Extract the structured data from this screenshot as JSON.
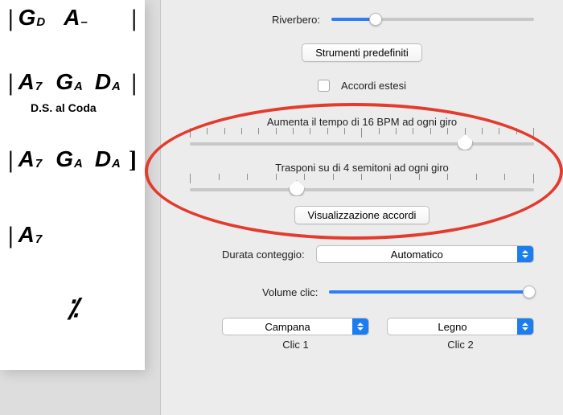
{
  "sheet": {
    "coda_text": "D.S. al Coda",
    "rows": [
      [
        {
          "root": "G",
          "sub": "D"
        },
        {
          "root": "A",
          "sub": "–"
        }
      ],
      [
        {
          "root": "A",
          "sub": "7"
        },
        {
          "root": "G",
          "sub": "A"
        },
        {
          "root": "D",
          "sub": "A"
        }
      ],
      [
        {
          "root": "A",
          "sub": "7"
        },
        {
          "root": "G",
          "sub": "A"
        },
        {
          "root": "D",
          "sub": "A"
        }
      ],
      [
        {
          "root": "A",
          "sub": "7"
        }
      ],
      [
        {
          "repeat": "⁒"
        }
      ]
    ]
  },
  "panel": {
    "reverb": {
      "label": "Riverbero:",
      "value_pct": 22
    },
    "defaults_btn": "Strumenti predefiniti",
    "extended": {
      "label": "Accordi estesi",
      "checked": false
    },
    "tempo_increase": {
      "label": "Aumenta il tempo di 16 BPM ad ogni giro",
      "value_pct": 80
    },
    "transpose": {
      "label": "Trasponi su di 4 semitoni ad ogni giro",
      "value_pct": 31
    },
    "chord_view_btn": "Visualizzazione accordi",
    "count_duration": {
      "label": "Durata conteggio:",
      "selected": "Automatico"
    },
    "click_volume": {
      "label": "Volume clic:",
      "value_pct": 100
    },
    "click1": {
      "selected": "Campana",
      "caption": "Clic 1"
    },
    "click2": {
      "selected": "Legno",
      "caption": "Clic 2"
    }
  }
}
